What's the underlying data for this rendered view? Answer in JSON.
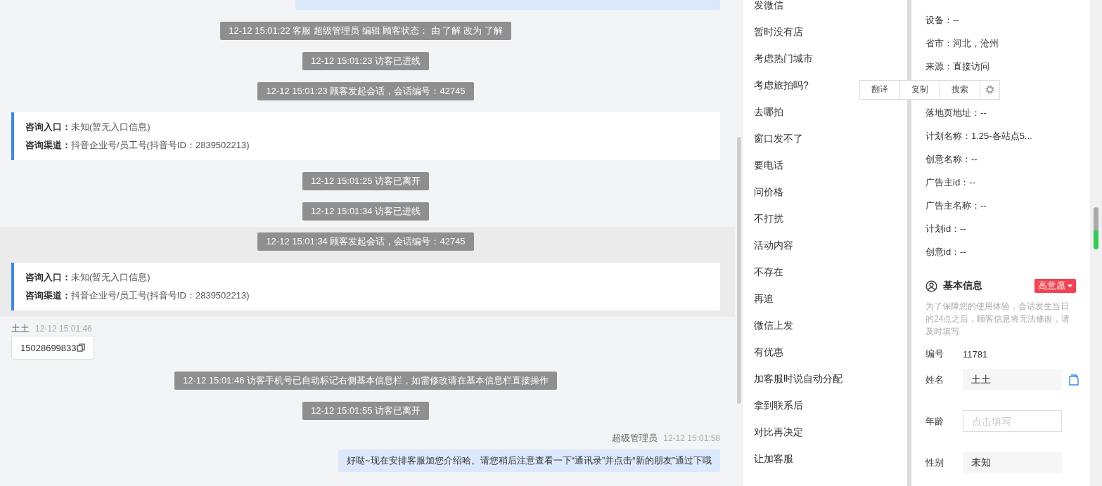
{
  "chat": {
    "items": [
      {
        "kind": "edge_bubble"
      },
      {
        "kind": "notice",
        "text": "12-12 15:01:22 客服 超级管理员 编辑 顾客状态： 由 了解 改为 了解"
      },
      {
        "kind": "notice",
        "text": "12-12 15:01:23 访客已进线"
      },
      {
        "kind": "notice",
        "text": "12-12 15:01:23 顾客发起会话，会话编号：42745"
      },
      {
        "kind": "entry_card",
        "rows": [
          {
            "label": "咨询入口：",
            "value": "未知(暂无入口信息)"
          },
          {
            "label": "咨询渠道：",
            "value": "抖音企业号/员工号(抖音号ID：2839502213)"
          }
        ]
      },
      {
        "kind": "notice",
        "text": "12-12 15:01:25 访客已离开"
      },
      {
        "kind": "notice",
        "text": "12-12 15:01:34 访客已进线"
      },
      {
        "kind": "highlighted_group",
        "items": [
          {
            "kind": "notice",
            "text": "12-12 15:01:34 顾客发起会话，会话编号：42745"
          },
          {
            "kind": "entry_card",
            "rows": [
              {
                "label": "咨询入口：",
                "value": "未知(暂无入口信息)"
              },
              {
                "label": "咨询渠道：",
                "value": "抖音企业号/员工号(抖音号ID：2839502213)"
              }
            ]
          }
        ]
      },
      {
        "kind": "visitor_sender",
        "name": "土土",
        "time": "12-12 15:01:46"
      },
      {
        "kind": "incoming",
        "text": "15028699833"
      },
      {
        "kind": "notice",
        "text": "12-12 15:01:46 访客手机号已自动标记右侧基本信息栏，如需修改请在基本信息栏直接操作"
      },
      {
        "kind": "notice",
        "text": "12-12 15:01:55 访客已离开"
      },
      {
        "kind": "agent_sender",
        "name": "超级管理员",
        "time": "12-12 15:01:58"
      },
      {
        "kind": "outgoing",
        "text": "好哒~现在安排客服加您介绍哈。请您稍后注意查看一下“通讯录”并点击“新的朋友”通过下哦"
      }
    ]
  },
  "quick_replies": [
    "发微信",
    "暂时没有店",
    "考虑热门城市",
    "考虑旅拍吗?",
    "去哪拍",
    "窗口发不了",
    "要电话",
    "问价格",
    "不打扰",
    "活动内容",
    "不存在",
    "再追",
    "微信上发",
    "有优惠",
    "加客服时说自动分配",
    "拿到联系后",
    "对比再决定",
    "让加客服"
  ],
  "details": [
    "设备：--",
    "省市：河北，沧州",
    "来源：直接访问",
    "落地页地址：--",
    "计划名称：1.25-各站点5...",
    "创意名称：--",
    "广告主id：--",
    "广告主名称：--",
    "计划id：--",
    "创意id：--"
  ],
  "text_toolbar": {
    "buttons": [
      "翻译",
      "复制",
      "搜索"
    ]
  },
  "basic_info": {
    "title": "基本信息",
    "intent_tag": "高意愿",
    "notice": "为了保障您的使用体验，会话发生当日的24点之后，顾客信息将无法修改，请及时填写",
    "fields": [
      {
        "kind": "text",
        "label": "编号",
        "value": "11781"
      },
      {
        "kind": "filled",
        "label": "姓名",
        "value": "土土"
      },
      {
        "kind": "input",
        "label": "年龄",
        "placeholder": "点击填写"
      },
      {
        "kind": "filled",
        "label": "性别",
        "value": "未知"
      }
    ]
  }
}
